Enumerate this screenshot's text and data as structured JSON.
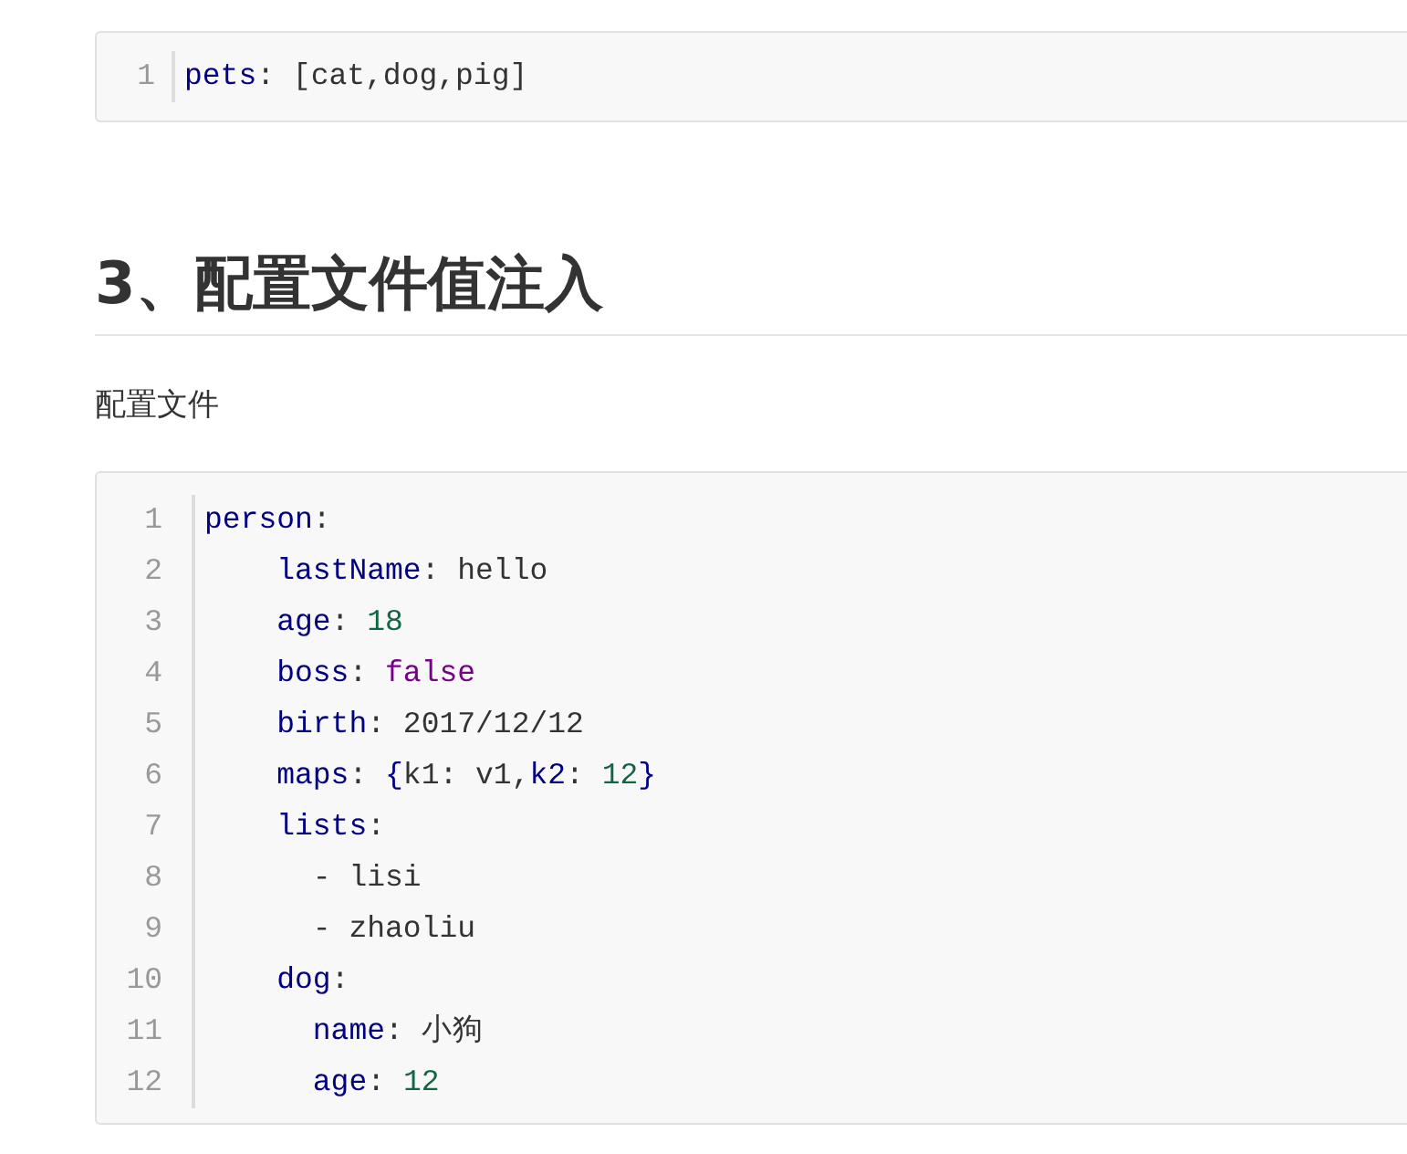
{
  "code_blocks": [
    {
      "lines": [
        {
          "number": "1",
          "tokens": [
            {
              "kind": "key",
              "text": "pets"
            },
            {
              "kind": "plain",
              "text": ": [cat,dog,pig]"
            }
          ]
        }
      ]
    },
    {
      "lines": [
        {
          "number": "1",
          "tokens": [
            {
              "kind": "key",
              "text": "person"
            },
            {
              "kind": "plain",
              "text": ":"
            }
          ],
          "children": [
            {
              "number": "2",
              "tokens": [
                {
                  "kind": "key",
                  "text": "lastName"
                },
                {
                  "kind": "plain",
                  "text": ": hello"
                }
              ]
            },
            {
              "number": "3",
              "tokens": [
                {
                  "kind": "key",
                  "text": "age"
                },
                {
                  "kind": "plain",
                  "text": ": "
                },
                {
                  "kind": "number",
                  "text": "18"
                }
              ]
            },
            {
              "number": "4",
              "tokens": [
                {
                  "kind": "key",
                  "text": "boss"
                },
                {
                  "kind": "plain",
                  "text": ": "
                },
                {
                  "kind": "bool",
                  "text": "false"
                }
              ]
            },
            {
              "number": "5",
              "tokens": [
                {
                  "kind": "key",
                  "text": "birth"
                },
                {
                  "kind": "plain",
                  "text": ": 2017/12/12"
                }
              ]
            },
            {
              "number": "6",
              "tokens": [
                {
                  "kind": "key",
                  "text": "maps"
                },
                {
                  "kind": "plain",
                  "text": ": "
                },
                {
                  "kind": "bracket",
                  "text": "{"
                },
                {
                  "kind": "plain",
                  "text": "k1: v1,"
                },
                {
                  "kind": "key",
                  "text": "k2"
                },
                {
                  "kind": "plain",
                  "text": ": "
                },
                {
                  "kind": "number",
                  "text": "12"
                },
                {
                  "kind": "bracket",
                  "text": "}"
                }
              ]
            },
            {
              "number": "7",
              "tokens": [
                {
                  "kind": "key",
                  "text": "lists"
                },
                {
                  "kind": "plain",
                  "text": ":"
                }
              ],
              "children": [
                {
                  "number": "8",
                  "tokens": [
                    {
                      "kind": "plain",
                      "text": "- lisi"
                    }
                  ]
                },
                {
                  "number": "9",
                  "tokens": [
                    {
                      "kind": "plain",
                      "text": "- zhaoliu"
                    }
                  ]
                }
              ]
            },
            {
              "number": "10",
              "tokens": [
                {
                  "kind": "key",
                  "text": "dog"
                },
                {
                  "kind": "plain",
                  "text": ":"
                }
              ],
              "children": [
                {
                  "number": "11",
                  "tokens": [
                    {
                      "kind": "key",
                      "text": "name"
                    },
                    {
                      "kind": "plain",
                      "text": ": 小狗"
                    }
                  ]
                },
                {
                  "number": "12",
                  "tokens": [
                    {
                      "kind": "key",
                      "text": "age"
                    },
                    {
                      "kind": "plain",
                      "text": ": "
                    },
                    {
                      "kind": "number",
                      "text": "12"
                    }
                  ]
                }
              ]
            }
          ]
        }
      ]
    }
  ],
  "heading": "3、配置文件值注入",
  "paragraph": "配置文件"
}
